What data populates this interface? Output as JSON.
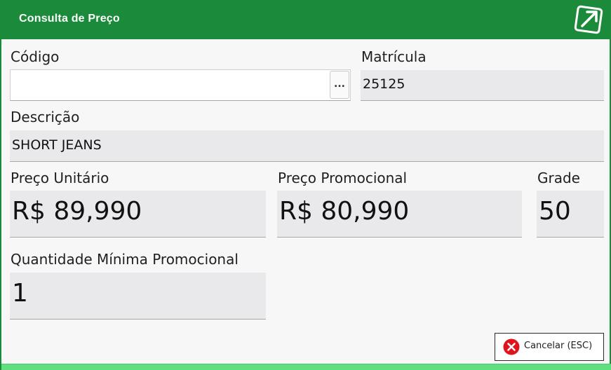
{
  "window": {
    "title": "Consulta de Preço"
  },
  "icons": {
    "title_icon": "open-external-arrow-icon",
    "browse_icon": "ellipsis",
    "cancel_icon": "close-circle-icon"
  },
  "colors": {
    "header": "#1b8a3a",
    "field_bg": "#e9e9ec",
    "cancel_icon": "#e0141d",
    "bottom_bar": "#5fe07f"
  },
  "fields": {
    "codigo": {
      "label": "Código",
      "value": "",
      "browse_label": "..."
    },
    "matricula": {
      "label": "Matrícula",
      "value": "25125"
    },
    "descricao": {
      "label": "Descrição",
      "value": "SHORT JEANS"
    },
    "preco_unitario": {
      "label": "Preço Unitário",
      "value": "R$ 89,990"
    },
    "preco_promocional": {
      "label": "Preço Promocional",
      "value": "R$ 80,990"
    },
    "grade": {
      "label": "Grade",
      "value": "50"
    },
    "qtd_min_promocional": {
      "label": "Quantidade Mínima Promocional",
      "value": "1"
    }
  },
  "actions": {
    "cancel_label": "Cancelar (ESC)"
  }
}
